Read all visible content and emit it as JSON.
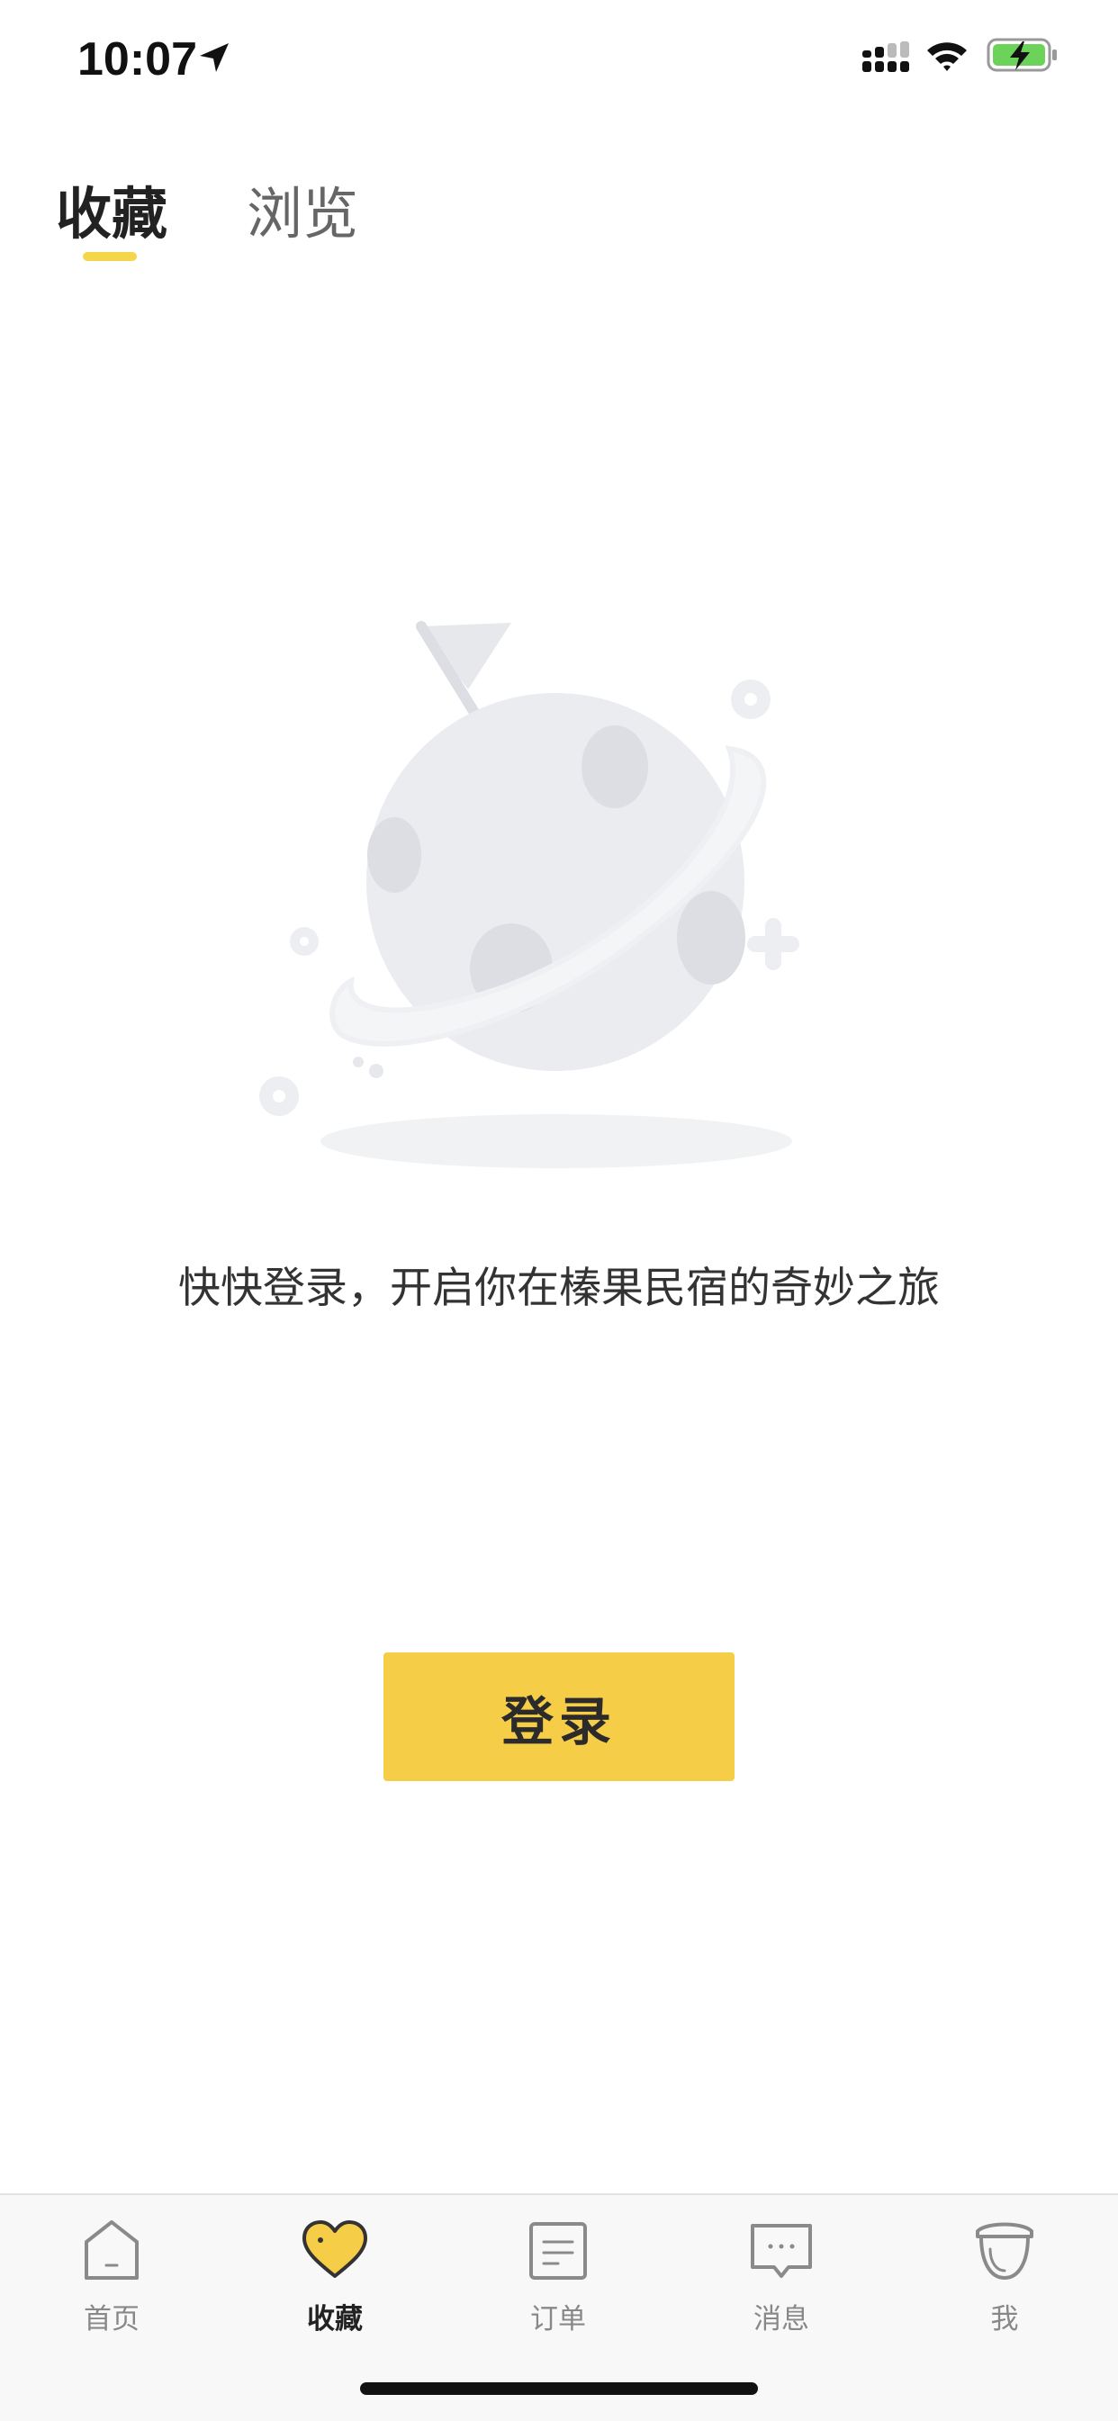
{
  "status_bar": {
    "time": "10:07"
  },
  "tabs": [
    {
      "label": "收藏",
      "active": true
    },
    {
      "label": "浏览",
      "active": false
    }
  ],
  "empty_state": {
    "message": "快快登录，开启你在榛果民宿的奇妙之旅",
    "login_label": "登录"
  },
  "tabbar": {
    "items": [
      {
        "label": "首页",
        "icon": "home-icon",
        "active": false
      },
      {
        "label": "收藏",
        "icon": "heart-icon",
        "active": true
      },
      {
        "label": "订单",
        "icon": "order-icon",
        "active": false
      },
      {
        "label": "消息",
        "icon": "message-icon",
        "active": false
      },
      {
        "label": "我",
        "icon": "profile-icon",
        "active": false
      }
    ]
  },
  "colors": {
    "accent": "#f6cd47",
    "tab_underline": "#f5d64a",
    "battery_fill": "#6cd35a"
  }
}
